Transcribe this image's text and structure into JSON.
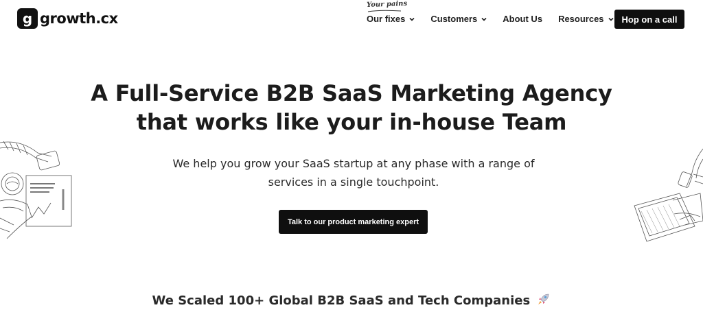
{
  "brand": {
    "logo_letter": "g",
    "name": "growth.cx"
  },
  "nav": {
    "annotation": "Your pains",
    "items": [
      {
        "label": "Our fixes",
        "has_dropdown": true
      },
      {
        "label": "Customers",
        "has_dropdown": true
      },
      {
        "label": "About Us",
        "has_dropdown": false
      },
      {
        "label": "Resources",
        "has_dropdown": true
      }
    ],
    "cta_label": "Hop on a call"
  },
  "hero": {
    "title_line1": "A Full-Service B2B SaaS Marketing Agency",
    "title_line2": "that works like your in-house Team",
    "subtitle_line1": "We help you grow your SaaS startup at any phase with a range of",
    "subtitle_line2": "services in a single touchpoint.",
    "cta_label": "Talk to our product marketing expert"
  },
  "social_proof": {
    "heading": "We Scaled 100+ Global B2B SaaS and Tech Companies",
    "icon": "rocket-icon"
  },
  "colors": {
    "primary": "#0f0f0f",
    "text": "#1c1c1c",
    "background": "#ffffff",
    "rocket_body": "#c9c9d6",
    "rocket_flame": "#e0527a"
  }
}
